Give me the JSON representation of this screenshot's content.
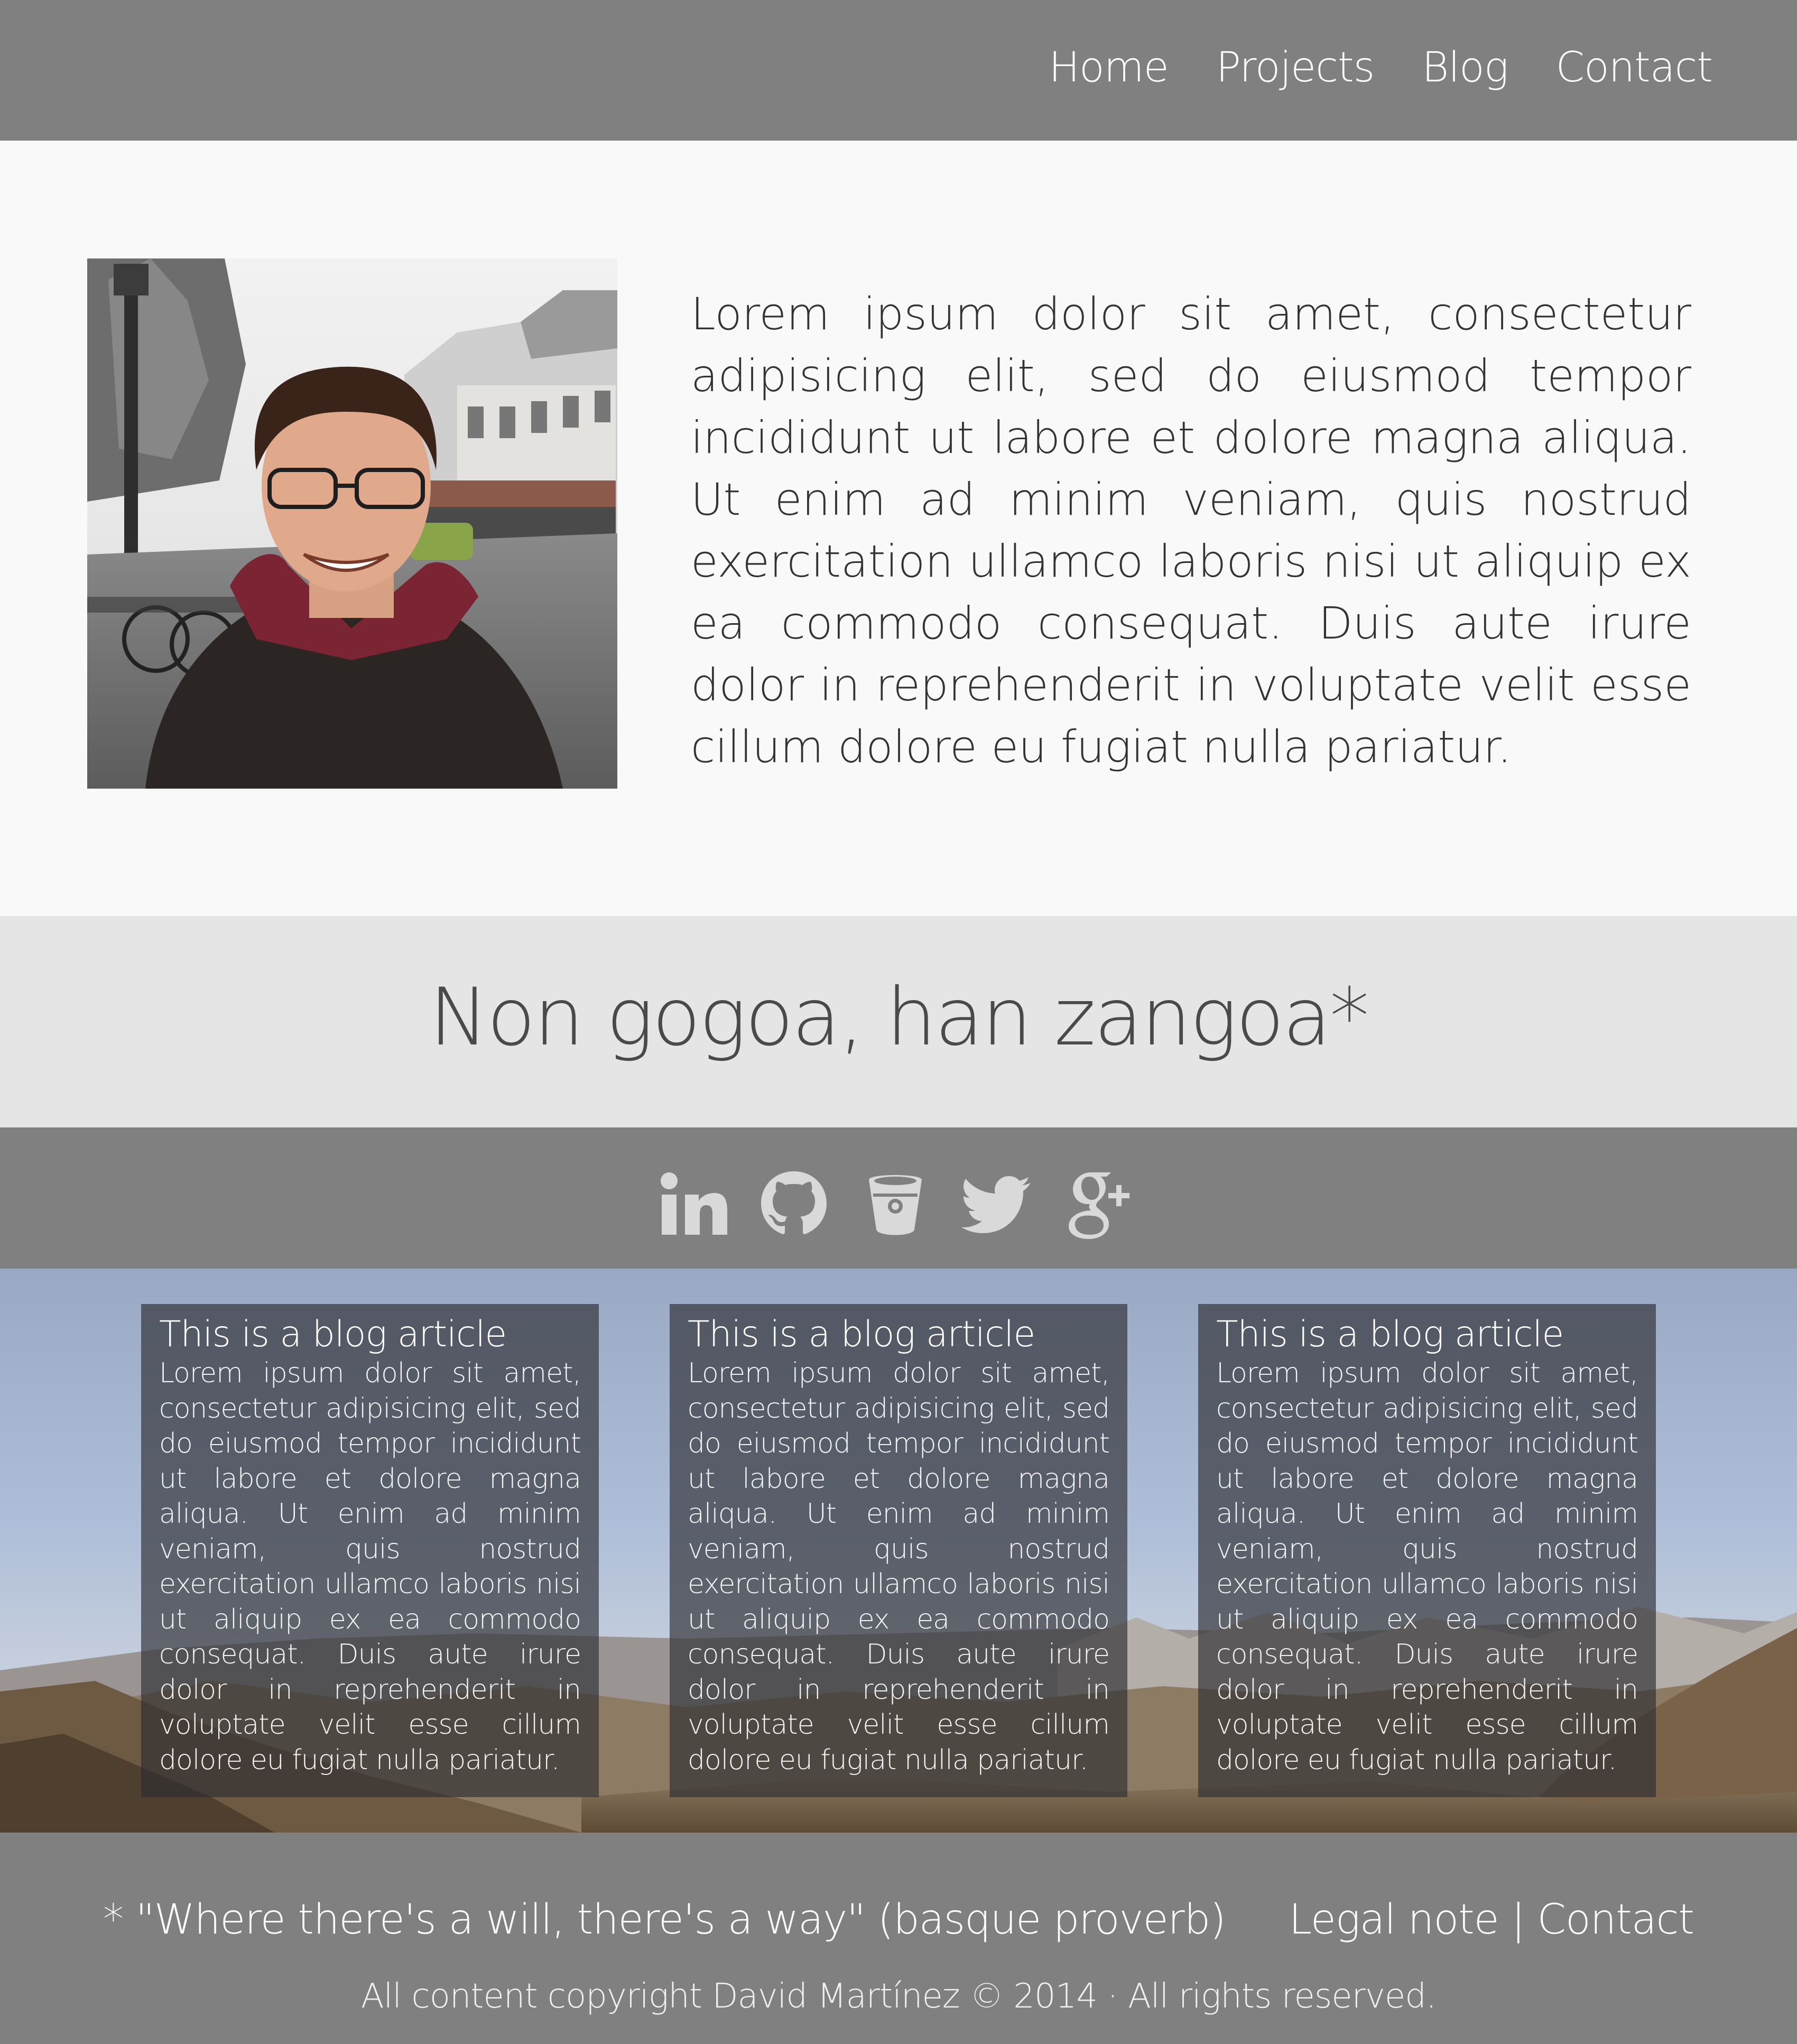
{
  "nav": {
    "items": [
      {
        "label": "Home"
      },
      {
        "label": "Projects"
      },
      {
        "label": "Blog"
      },
      {
        "label": "Contact"
      }
    ]
  },
  "about": {
    "text": "Lorem ipsum dolor sit amet, consectetur adipisicing elit, sed do eiusmod tempor incididunt ut labore et dolore magna aliqua. Ut enim ad minim veniam, quis nostrud exercitation ullamco laboris nisi ut aliquip ex ea commodo consequat. Duis aute irure dolor in reprehenderit in voluptate velit esse cillum dolore eu fugiat nulla pariatur."
  },
  "motto": {
    "text": "Non gogoa, han zangoa*"
  },
  "social": {
    "icons": [
      "linkedin-icon",
      "github-icon",
      "bitbucket-icon",
      "twitter-icon",
      "google-plus-icon"
    ]
  },
  "blog": {
    "cards": [
      {
        "title": "This is a blog article",
        "body": "Lorem ipsum dolor sit amet, consectetur adipisicing elit, sed do eiusmod tempor incididunt ut labore et dolore magna aliqua. Ut enim ad minim veniam, quis nostrud exercitation ullamco laboris nisi ut aliquip ex ea commodo consequat. Duis aute irure dolor in reprehenderit in voluptate velit esse cillum dolore eu fugiat nulla pariatur."
      },
      {
        "title": "This is a blog article",
        "body": "Lorem ipsum dolor sit amet, consectetur adipisicing elit, sed do eiusmod tempor incididunt ut labore et dolore magna aliqua. Ut enim ad minim veniam, quis nostrud exercitation ullamco laboris nisi ut aliquip ex ea commodo consequat. Duis aute irure dolor in reprehenderit in voluptate velit esse cillum dolore eu fugiat nulla pariatur."
      },
      {
        "title": "This is a blog article",
        "body": "Lorem ipsum dolor sit amet, consectetur adipisicing elit, sed do eiusmod tempor incididunt ut labore et dolore magna aliqua. Ut enim ad minim veniam, quis nostrud exercitation ullamco laboris nisi ut aliquip ex ea commodo consequat. Duis aute irure dolor in reprehenderit in voluptate velit esse cillum dolore eu fugiat nulla pariatur."
      }
    ]
  },
  "footer": {
    "quote": "* \"Where there's a will, there's a way\" (basque proverb)",
    "legal_label": "Legal note",
    "separator": " | ",
    "contact_label": "Contact",
    "copyright": "All content copyright David Martínez © 2014 · All rights reserved."
  },
  "colors": {
    "nav_bg": "#808080",
    "about_bg": "#f9f9f9",
    "motto_bg": "#e5e5e5",
    "footer_bg": "#808080",
    "card_bg": "rgba(45,45,50,0.66)"
  }
}
